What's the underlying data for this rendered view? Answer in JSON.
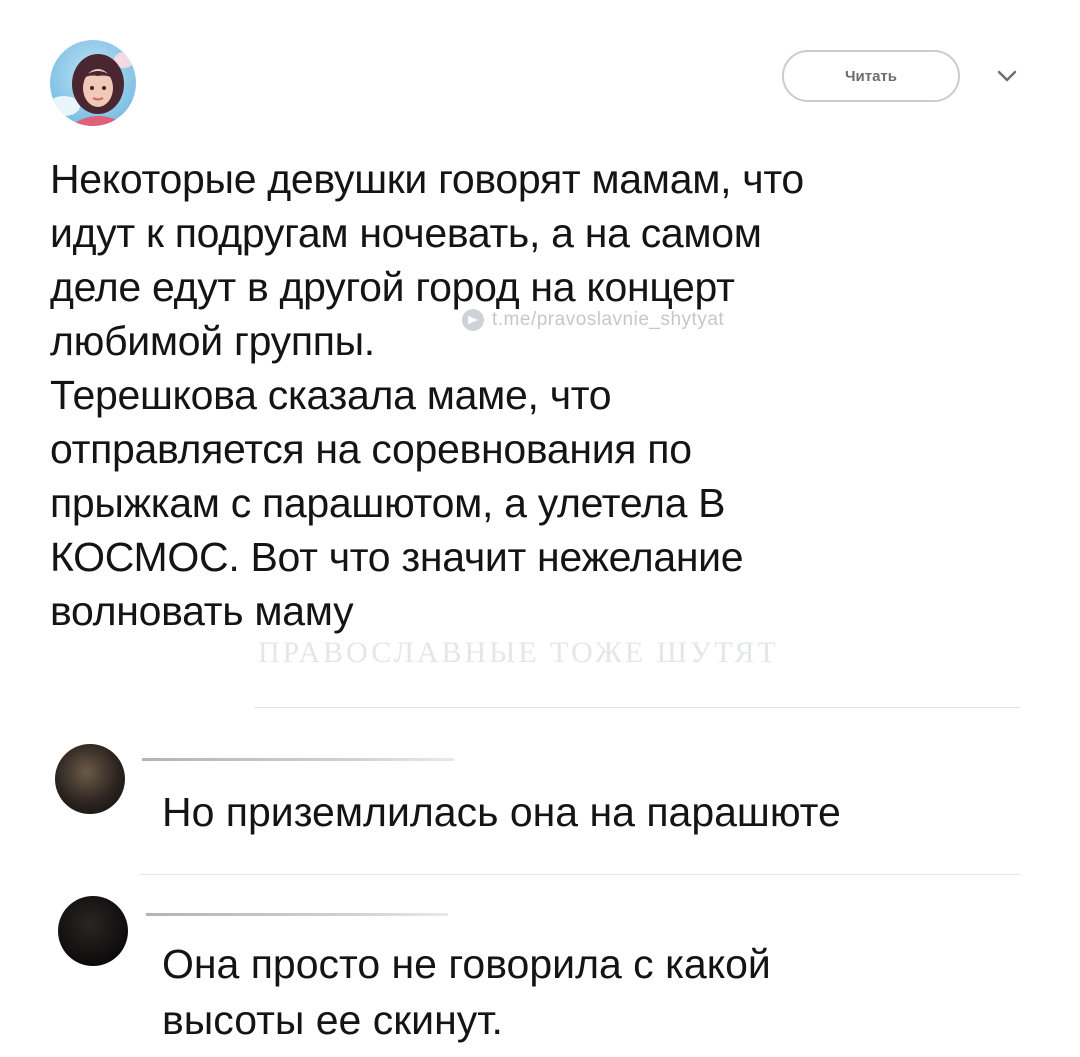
{
  "header": {
    "follow_label": "Читать",
    "avatar_icon": "user-avatar",
    "menu_icon": "chevron-down-icon"
  },
  "tweet": {
    "lines": [
      "Некоторые девушки говорят мамам, что",
      "идут к подругам ночевать, а на самом",
      "деле едут в другой город на концерт",
      "любимой группы.",
      "Терешкова сказала маме, что",
      "отправляется на соревнования по",
      "прыжкам с парашютом, а улетела В",
      "КОСМОС. Вот что значит нежелание",
      "волновать маму"
    ]
  },
  "watermarks": {
    "telegram": "t.me/pravoslavnie_shytyat",
    "channel": "ПРАВОСЛАВНЫЕ ТОЖЕ ШУТЯТ"
  },
  "replies": [
    {
      "lines": [
        "Но приземлилась она на парашюте"
      ]
    },
    {
      "lines": [
        "Она просто не говорила с какой",
        "высоты ее скинут."
      ]
    }
  ],
  "colors": {
    "text": "#141414",
    "follow_border": "#c9cdd1",
    "follow_text": "#6a6f74",
    "divider": "#e3e5e7"
  }
}
